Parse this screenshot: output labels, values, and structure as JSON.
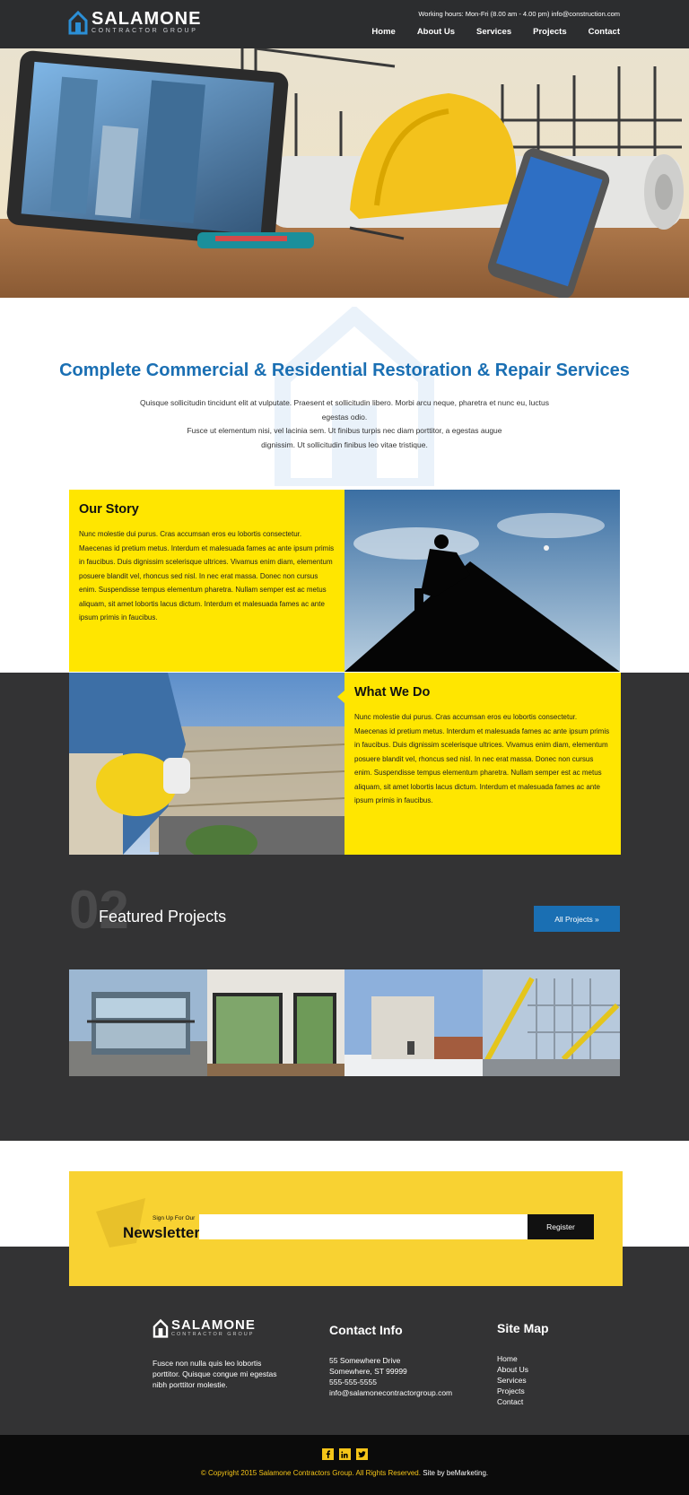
{
  "header": {
    "brand": "SALAMONE",
    "brand_sub": "CONTRACTOR GROUP",
    "hours": "Working hours: Mon-Fri (8.00 am - 4.00 pm) info@construction.com",
    "nav": [
      "Home",
      "About Us",
      "Services",
      "Projects",
      "Contact"
    ]
  },
  "intro": {
    "title": "Complete Commercial & Residential Restoration & Repair Services",
    "text_lines": [
      "Quisque sollicitudin tincidunt elit at vulputate. Praesent et sollicitudin libero. Morbi arcu neque, pharetra et nunc eu, luctus egestas odio.",
      "Fusce ut elementum nisi, vel lacinia sem. Ut finibus turpis nec diam porttitor, a egestas augue",
      "dignissim. Ut sollicitudin finibus leo vitae tristique."
    ]
  },
  "story": {
    "title": "Our Story",
    "text": "Nunc molestie dui purus. Cras accumsan eros eu lobortis consectetur. Maecenas id pretium metus. Interdum et malesuada fames ac ante ipsum primis in faucibus. Duis dignissim scelerisque ultrices. Vivamus enim diam, elementum posuere blandit vel, rhoncus sed nisl. In nec erat massa. Donec non cursus enim. Suspendisse tempus elementum pharetra. Nullam semper est ac metus aliquam, sit amet lobortis lacus dictum. Interdum et malesuada fames ac ante ipsum primis in faucibus."
  },
  "what_we_do": {
    "title": "What We Do",
    "text": "Nunc molestie dui purus. Cras accumsan eros eu lobortis consectetur. Maecenas id pretium metus. Interdum et malesuada fames ac ante ipsum primis in faucibus. Duis dignissim scelerisque ultrices. Vivamus enim diam, elementum posuere blandit vel, rhoncus sed nisl. In nec erat massa. Donec non cursus enim. Suspendisse tempus elementum pharetra. Nullam semper est ac metus aliquam, sit amet lobortis lacus dictum. Interdum et malesuada fames ac ante ipsum primis in faucibus."
  },
  "featured": {
    "number": "02",
    "title": "Featured Projects",
    "button": "All Projects »"
  },
  "newsletter": {
    "small": "Sign Up For Our",
    "big": "Newsletter",
    "input_placeholder": "",
    "button": "Register"
  },
  "footer": {
    "about": "Fusce non nulla quis leo lobortis porttitor. Quisque congue mi egestas nibh porttitor molestie.",
    "contact_title": "Contact Info",
    "contact_lines": [
      "55 Somewhere Drive",
      "Somewhere, ST 99999",
      "555-555-5555",
      "info@salamonecontractorgroup.com"
    ],
    "sitemap_title": "Site Map",
    "sitemap": [
      "Home",
      "About Us",
      "Services",
      "Projects",
      "Contact"
    ],
    "copyright": "© Copyright 2015 Salamone Contractors Group. All Rights Reserved.",
    "site_by": "Site by beMarketing.",
    "social_icons": [
      "facebook-icon",
      "linkedin-icon",
      "twitter-icon"
    ]
  },
  "colors": {
    "accent_blue": "#1a6fb3",
    "yellow": "#ffe600",
    "dark": "#333334"
  }
}
